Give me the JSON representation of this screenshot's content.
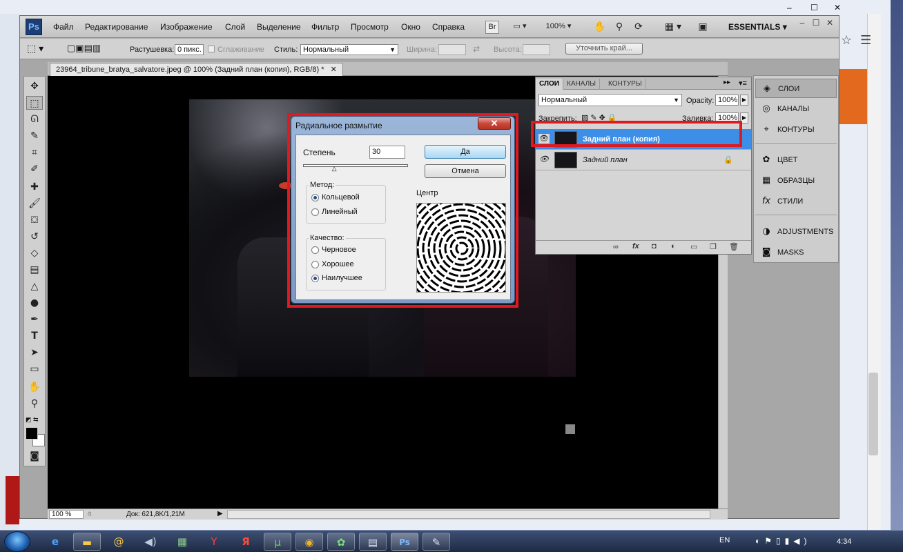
{
  "photoshop": {
    "logo": "Ps",
    "menu": [
      "Файл",
      "Редактирование",
      "Изображение",
      "Слой",
      "Выделение",
      "Фильтр",
      "Просмотр",
      "Окно",
      "Справка"
    ],
    "toolbar": {
      "br": "Br",
      "zoom": "100%",
      "workspace": "ESSENTIALS"
    },
    "window_controls": {
      "minimize": "–",
      "maximize": "☐",
      "close": "✕"
    },
    "options": {
      "feather_label": "Растушевка:",
      "feather_value": "0 пикс.",
      "antialias_label": "Сглаживание",
      "style_label": "Стиль:",
      "style_value": "Нормальный",
      "width_label": "Ширина:",
      "height_label": "Высота:",
      "refine_label": "Уточнить край..."
    },
    "document": {
      "tab_title": "23964_tribune_bratya_salvatore.jpeg @ 100% (Задний план (копия), RGB/8) *",
      "tab_close": "✕",
      "zoom": "100 %",
      "doc_info": "Док: 621,8K/1,21M"
    },
    "layers_panel": {
      "tabs": [
        "СЛОИ",
        "КАНАЛЫ",
        "КОНТУРЫ"
      ],
      "blend_mode": "Нормальный",
      "opacity_label": "Opacity:",
      "opacity_value": "100%",
      "lock_label": "Закрепить:",
      "fill_label": "Заливка:",
      "fill_value": "100%",
      "layers": [
        {
          "name": "Задний план (копия)",
          "selected": true
        },
        {
          "name": "Задний план",
          "selected": false,
          "locked": true
        }
      ],
      "footer_icons": [
        "link-icon",
        "fx-icon",
        "mask-icon",
        "adjustment-icon",
        "folder-icon",
        "new-layer-icon",
        "trash-icon"
      ]
    },
    "dock": {
      "groups": [
        [
          "СЛОИ",
          "КАНАЛЫ",
          "КОНТУРЫ"
        ],
        [
          "ЦВЕТ",
          "ОБРАЗЦЫ",
          "СТИЛИ"
        ],
        [
          "ADJUSTMENTS",
          "MASKS"
        ]
      ]
    }
  },
  "dialog": {
    "title": "Радиальное размытие",
    "amount_label": "Степень",
    "amount_value": "30",
    "amount_fraction": 0.3,
    "ok": "Да",
    "cancel": "Отмена",
    "method_label": "Метод:",
    "method_options": [
      "Кольцевой",
      "Линейный"
    ],
    "method_selected": 0,
    "quality_label": "Качество:",
    "quality_options": [
      "Черновое",
      "Хорошее",
      "Наилучшее"
    ],
    "quality_selected": 2,
    "center_label": "Центр"
  },
  "taskbar": {
    "lang": "EN",
    "time": "4:34"
  },
  "colors": {
    "highlight": "#e0191f",
    "selection": "#3d8ee6"
  }
}
